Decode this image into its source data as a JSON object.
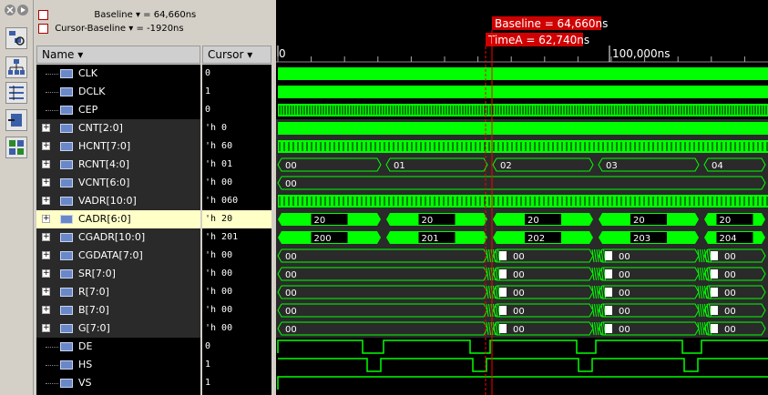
{
  "toolbar": {
    "icons": [
      "close-icon",
      "pin-icon",
      "hierarchy-search-icon",
      "hierarchy-icon",
      "signal-list-icon",
      "insert-icon",
      "group-icon"
    ]
  },
  "header": {
    "baseline_label": "Baseline ▾ = 64,660ns",
    "cursor_baseline_label": "Cursor-Baseline ▾ = -1920ns"
  },
  "columns": {
    "name": "Name ▾",
    "cursor": "Cursor ▾"
  },
  "timeline": {
    "tick_0": "0",
    "tick_100k": "100,000ns",
    "baseline_marker": "Baseline = 64,660ns",
    "timea_marker": "TimeA = 62,740ns"
  },
  "colors": {
    "wave_green": "#00ff00",
    "marker_red": "#ff0000",
    "selected_row": "#ffffc8",
    "row_dark": "#303030"
  },
  "signals": [
    {
      "name": "CLK",
      "value": "0",
      "expandable": false,
      "kind": "clock"
    },
    {
      "name": "DCLK",
      "value": "1",
      "expandable": false,
      "kind": "clock"
    },
    {
      "name": "CEP",
      "value": "0",
      "expandable": false,
      "kind": "dense"
    },
    {
      "name": "CNT[2:0]",
      "value": "'h 0",
      "expandable": true,
      "kind": "solid"
    },
    {
      "name": "HCNT[7:0]",
      "value": "'h 60",
      "expandable": true,
      "kind": "dense"
    },
    {
      "name": "RCNT[4:0]",
      "value": "'h 01",
      "expandable": true,
      "kind": "bus",
      "labels": [
        "00",
        "01",
        "02",
        "03",
        "04"
      ]
    },
    {
      "name": "VCNT[6:0]",
      "value": "'h 00",
      "expandable": true,
      "kind": "bus",
      "labels": [
        "00"
      ]
    },
    {
      "name": "VADR[10:0]",
      "value": "'h 060",
      "expandable": true,
      "kind": "dense"
    },
    {
      "name": "CADR[6:0]",
      "value": "'h 20",
      "expandable": true,
      "kind": "bus",
      "selected": true,
      "labels": [
        "20",
        "20",
        "20",
        "20",
        "20"
      ]
    },
    {
      "name": "CGADR[10:0]",
      "value": "'h 201",
      "expandable": true,
      "kind": "bus",
      "labels": [
        "200",
        "201",
        "202",
        "203",
        "204"
      ]
    },
    {
      "name": "CGDATA[7:0]",
      "value": "'h 00",
      "expandable": true,
      "kind": "bus",
      "labels": [
        "00",
        "00",
        "00",
        "00"
      ]
    },
    {
      "name": "SR[7:0]",
      "value": "'h 00",
      "expandable": true,
      "kind": "bus",
      "labels": [
        "00",
        "00",
        "00",
        "00"
      ]
    },
    {
      "name": "R[7:0]",
      "value": "'h 00",
      "expandable": true,
      "kind": "bus",
      "labels": [
        "00",
        "00",
        "00",
        "00"
      ]
    },
    {
      "name": "B[7:0]",
      "value": "'h 00",
      "expandable": true,
      "kind": "bus",
      "labels": [
        "00",
        "00",
        "00",
        "00"
      ]
    },
    {
      "name": "G[7:0]",
      "value": "'h 00",
      "expandable": true,
      "kind": "bus",
      "labels": [
        "00",
        "00",
        "00",
        "00"
      ]
    },
    {
      "name": "DE",
      "value": "0",
      "expandable": false,
      "kind": "de"
    },
    {
      "name": "HS",
      "value": "1",
      "expandable": false,
      "kind": "hs"
    },
    {
      "name": "VS",
      "value": "1",
      "expandable": false,
      "kind": "high"
    }
  ]
}
